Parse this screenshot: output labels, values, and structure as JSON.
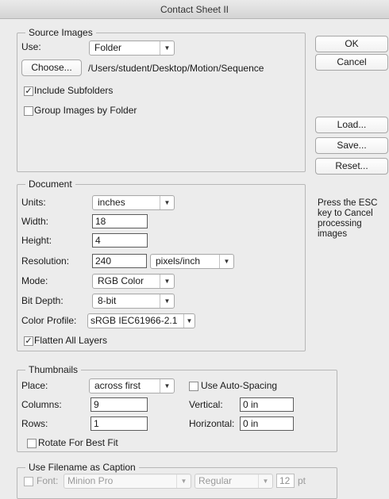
{
  "window": {
    "title": "Contact Sheet II"
  },
  "source_images": {
    "legend": "Source Images",
    "use_label": "Use:",
    "use_value": "Folder",
    "choose_button": "Choose...",
    "path": "/Users/student/Desktop/Motion/Sequence",
    "include_subfolders": {
      "label": "Include Subfolders",
      "checked": true,
      "mark": "✓"
    },
    "group_by_folder": {
      "label": "Group Images by Folder",
      "checked": false,
      "mark": ""
    }
  },
  "buttons": {
    "ok": "OK",
    "cancel": "Cancel",
    "load": "Load...",
    "save": "Save...",
    "reset": "Reset..."
  },
  "hint": {
    "line1": "Press the ESC",
    "line2": "key to Cancel",
    "line3": "processing",
    "line4": "images"
  },
  "document": {
    "legend": "Document",
    "units_label": "Units:",
    "units_value": "inches",
    "width_label": "Width:",
    "width_value": "18",
    "height_label": "Height:",
    "height_value": "4",
    "resolution_label": "Resolution:",
    "resolution_value": "240",
    "resolution_unit": "pixels/inch",
    "mode_label": "Mode:",
    "mode_value": "RGB Color",
    "bitdepth_label": "Bit Depth:",
    "bitdepth_value": "8-bit",
    "profile_label": "Color Profile:",
    "profile_value": "sRGB IEC61966-2.1",
    "flatten": {
      "label": "Flatten All Layers",
      "checked": true,
      "mark": "✓"
    }
  },
  "thumbnails": {
    "legend": "Thumbnails",
    "place_label": "Place:",
    "place_value": "across first",
    "auto_spacing": {
      "label": "Use Auto-Spacing",
      "checked": false,
      "mark": ""
    },
    "columns_label": "Columns:",
    "columns_value": "9",
    "rows_label": "Rows:",
    "rows_value": "1",
    "vertical_label": "Vertical:",
    "vertical_value": "0 in",
    "horizontal_label": "Horizontal:",
    "horizontal_value": "0 in",
    "rotate": {
      "label": "Rotate For Best Fit",
      "checked": false,
      "mark": ""
    }
  },
  "caption": {
    "legend": "Use Filename as Caption",
    "font_label": "Font:",
    "font_value": "Minion Pro",
    "style_value": "Regular",
    "size_value": "12",
    "size_unit": "pt"
  },
  "icons": {
    "dropdown_arrow": "▼"
  }
}
